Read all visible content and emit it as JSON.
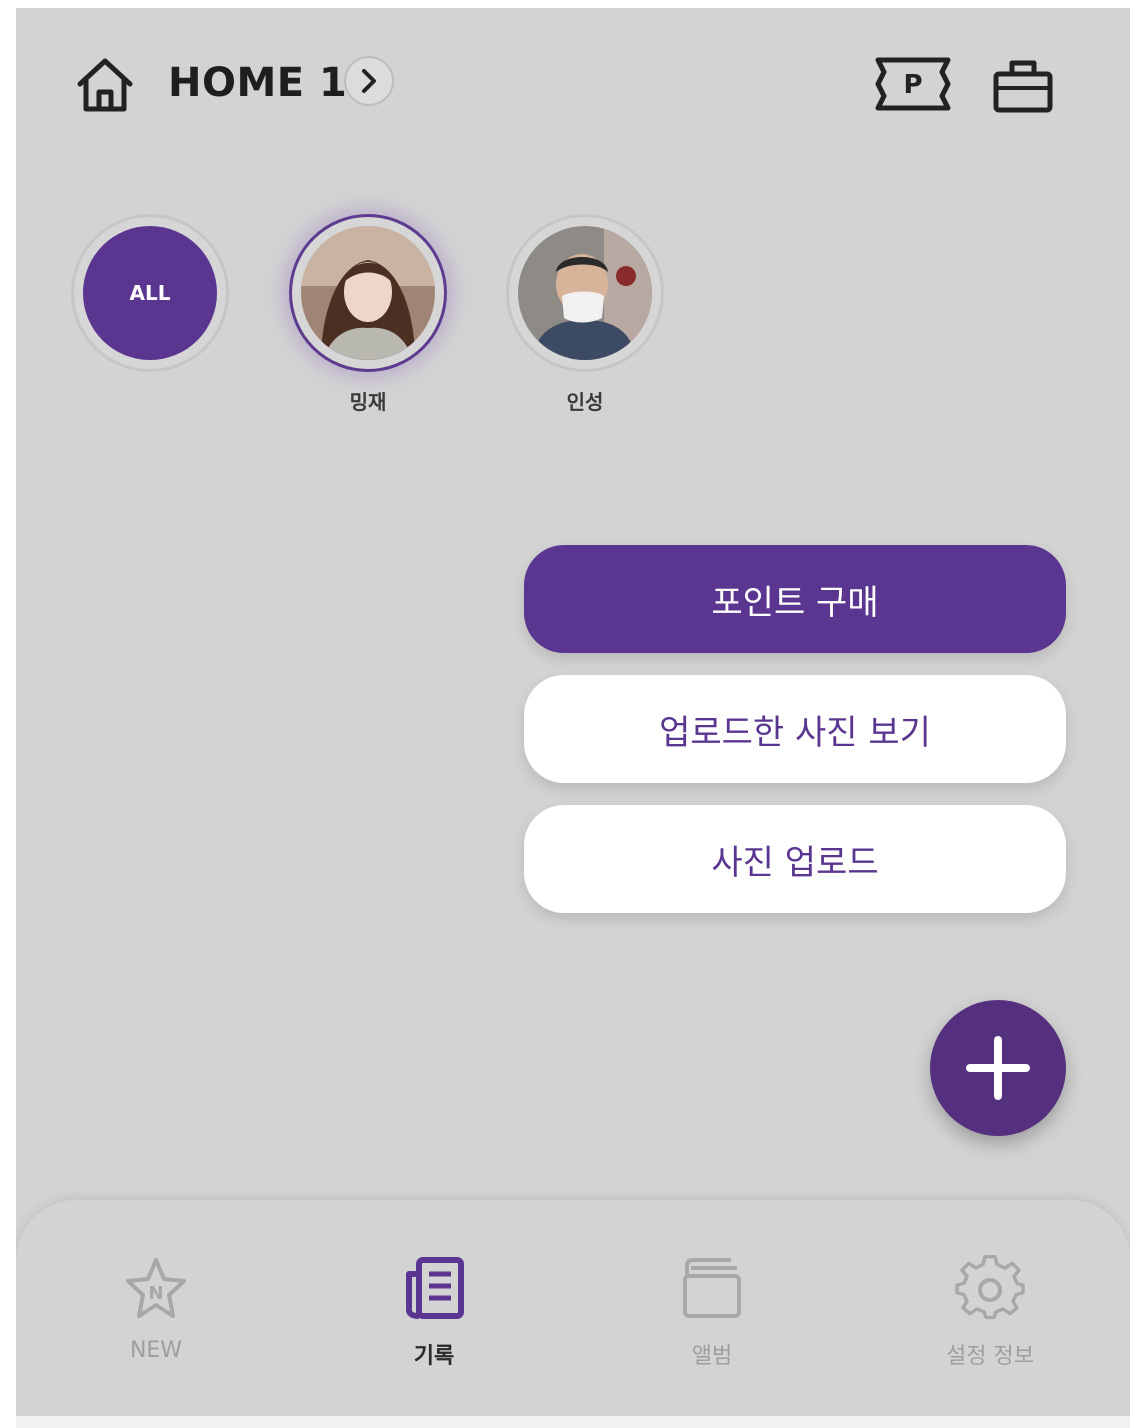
{
  "header": {
    "title": "HOME 1",
    "icons": [
      "home-icon",
      "chevron-right-icon",
      "point-ticket-icon",
      "shopping-bag-icon"
    ],
    "ticket_letter": "P"
  },
  "members": [
    {
      "label": "ALL",
      "name": "",
      "selected": false
    },
    {
      "label": "",
      "name": "밍재",
      "selected": true
    },
    {
      "label": "",
      "name": "인성",
      "selected": false
    }
  ],
  "menu": {
    "buy_points": "포인트 구매",
    "view_uploaded": "업로드한 사진 보기",
    "upload_photo": "사진 업로드"
  },
  "fab_icon": "plus-icon",
  "bottom_nav": [
    {
      "label": "NEW",
      "icon": "star-new-icon",
      "active": false
    },
    {
      "label": "기록",
      "icon": "records-icon",
      "active": true
    },
    {
      "label": "앨범",
      "icon": "album-icon",
      "active": false
    },
    {
      "label": "설정 정보",
      "icon": "gear-icon",
      "active": false
    }
  ],
  "colors": {
    "accent": "#5b3690",
    "background": "#d3d3d3",
    "inactive_text": "#9e9e9e"
  }
}
